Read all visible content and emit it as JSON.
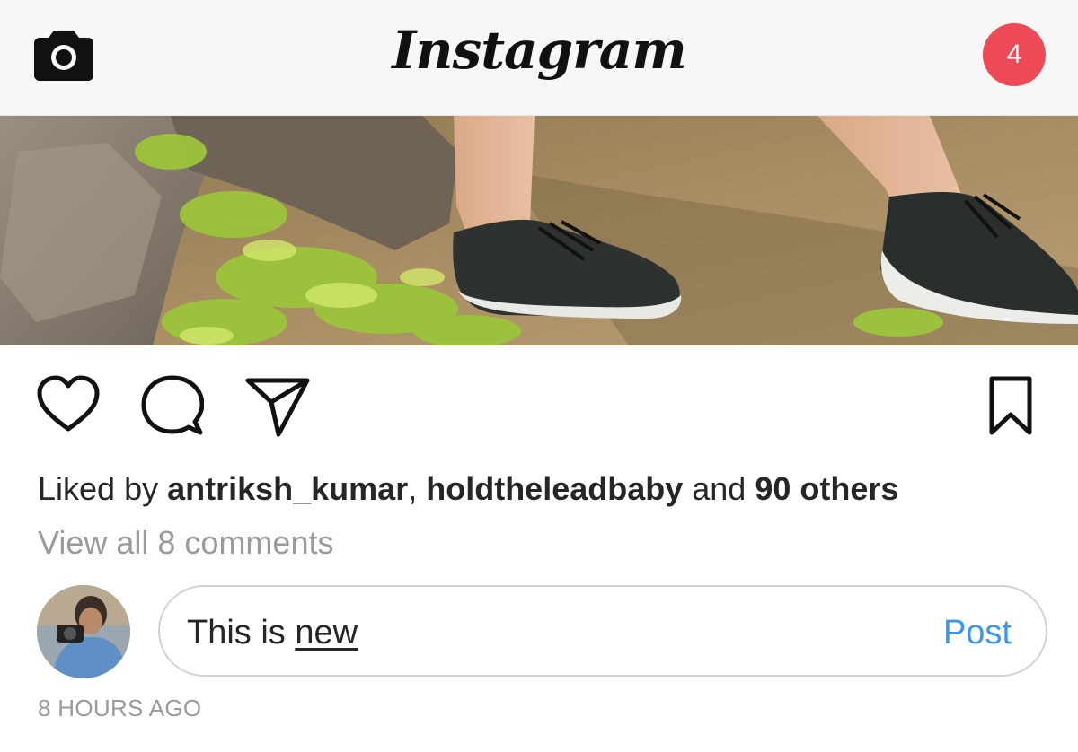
{
  "header": {
    "logo_text": "Instagram",
    "camera_icon": "camera-icon",
    "notification_count": "4",
    "badge_color": "#ed4956"
  },
  "post": {
    "photo_description_icon": "post-image",
    "actions": {
      "like_icon": "heart-icon",
      "comment_icon": "comment-bubble-icon",
      "share_icon": "paper-plane-icon",
      "save_icon": "bookmark-icon"
    },
    "likes": {
      "prefix": "Liked by ",
      "user1": "antriksh_kumar",
      "separator": ", ",
      "user2": "holdtheleadbaby",
      "middle": " and ",
      "others": "90 others"
    },
    "view_all_comments": "View all 8 comments",
    "comment_input": {
      "value_plain": "This is ",
      "value_underlined": "new"
    },
    "post_button": "Post",
    "post_button_color": "#3897f0",
    "timestamp": "8 HOURS AGO"
  }
}
